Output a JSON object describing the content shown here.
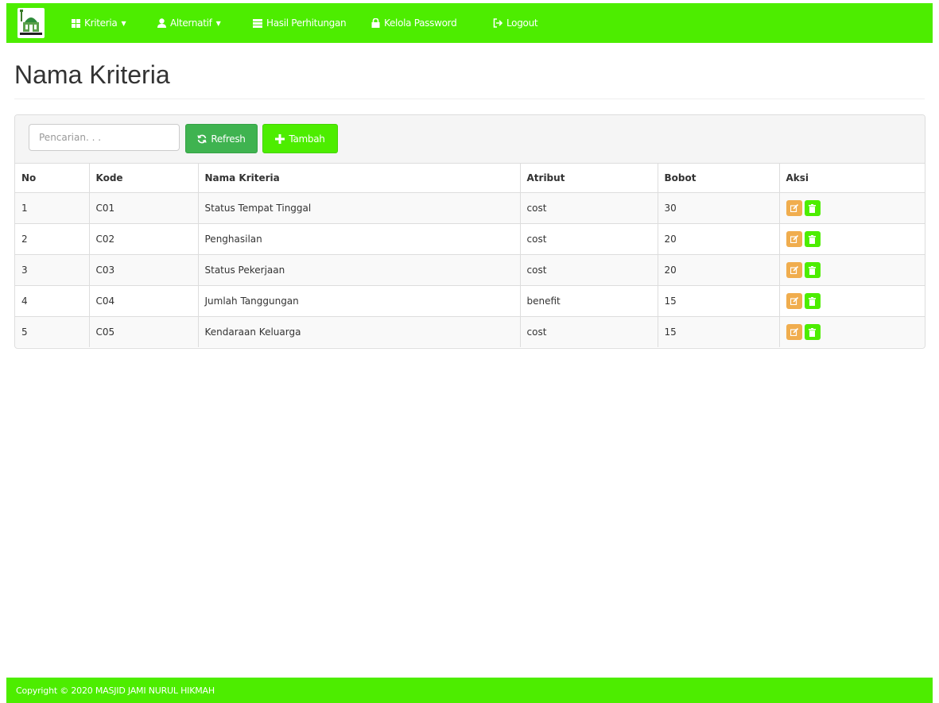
{
  "nav": {
    "items": [
      {
        "label": "Kriteria",
        "icon": "th-large-icon",
        "dropdown": true
      },
      {
        "label": "Alternatif",
        "icon": "user-icon",
        "dropdown": true
      },
      {
        "label": "Hasil Perhitungan",
        "icon": "list-icon",
        "dropdown": false
      },
      {
        "label": "Kelola Password",
        "icon": "lock-icon",
        "dropdown": false
      },
      {
        "label": "Logout",
        "icon": "logout-icon",
        "dropdown": false
      }
    ]
  },
  "page": {
    "title": "Nama Kriteria"
  },
  "toolbar": {
    "search_placeholder": "Pencarian. . .",
    "refresh_label": "Refresh",
    "add_label": "Tambah"
  },
  "table": {
    "headers": [
      "No",
      "Kode",
      "Nama Kriteria",
      "Atribut",
      "Bobot",
      "Aksi"
    ],
    "rows": [
      {
        "no": "1",
        "kode": "C01",
        "nama": "Status Tempat Tinggal",
        "atribut": "cost",
        "bobot": "30"
      },
      {
        "no": "2",
        "kode": "C02",
        "nama": "Penghasilan",
        "atribut": "cost",
        "bobot": "20"
      },
      {
        "no": "3",
        "kode": "C03",
        "nama": "Status Pekerjaan",
        "atribut": "cost",
        "bobot": "20"
      },
      {
        "no": "4",
        "kode": "C04",
        "nama": "Jumlah Tanggungan",
        "atribut": "benefit",
        "bobot": "15"
      },
      {
        "no": "5",
        "kode": "C05",
        "nama": "Kendaraan Keluarga",
        "atribut": "cost",
        "bobot": "15"
      }
    ]
  },
  "footer": {
    "text": "Copyright © 2020 MASJID JAMI NURUL HIKMAH"
  },
  "colors": {
    "brand": "#4ded00",
    "refresh": "#3fb350",
    "edit": "#f0ad4e"
  }
}
